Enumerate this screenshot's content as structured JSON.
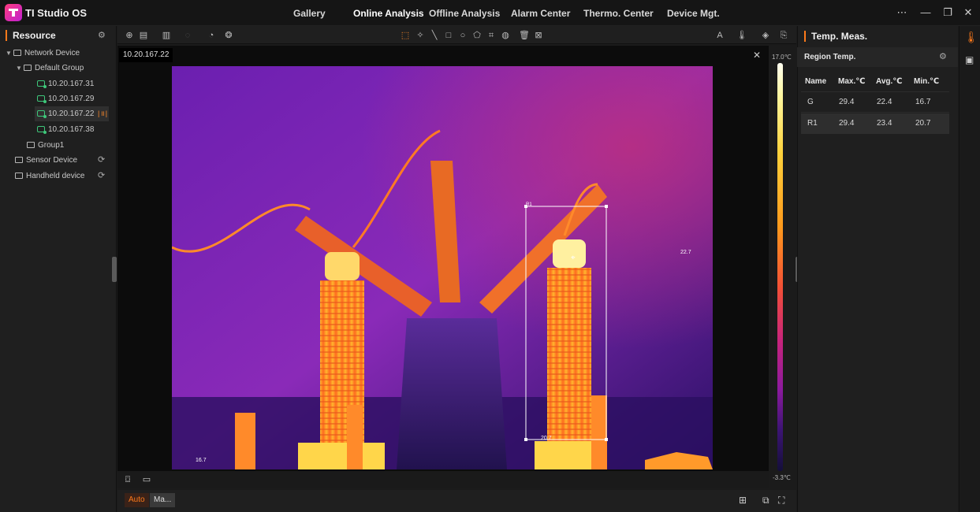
{
  "app": {
    "title": "TI Studio OS"
  },
  "nav": {
    "tabs": [
      "Gallery",
      "Online Analysis",
      "Offline Analysis",
      "Alarm Center",
      "Thermo. Center",
      "Device Mgt."
    ],
    "active": "Online Analysis"
  },
  "window_controls": {
    "more": "⋯",
    "minimize": "—",
    "restore": "❐",
    "close": "✕"
  },
  "resource": {
    "title": "Resource",
    "tree": [
      {
        "label": "Network Device",
        "level": 0,
        "type": "folder",
        "expanded": true
      },
      {
        "label": "Default Group",
        "level": 1,
        "type": "folder",
        "expanded": true
      },
      {
        "label": "10.20.167.31",
        "level": 2,
        "type": "camera"
      },
      {
        "label": "10.20.167.29",
        "level": 2,
        "type": "camera"
      },
      {
        "label": "10.20.167.22",
        "level": 2,
        "type": "camera",
        "selected": true,
        "live": true
      },
      {
        "label": "10.20.167.38",
        "level": 2,
        "type": "camera"
      },
      {
        "label": "Group1",
        "level": 1,
        "type": "folder"
      },
      {
        "label": "Sensor Device",
        "level": 0,
        "type": "folder",
        "refresh": true
      },
      {
        "label": "Handheld device",
        "level": 0,
        "type": "folder",
        "refresh": true
      }
    ]
  },
  "video": {
    "tab": "10.20.167.22",
    "scale_max": "17.0℃",
    "scale_min": "-3.3℃",
    "overlay": {
      "region_label": "R1",
      "point_right": "22.7",
      "point_bottom": "20.7",
      "point_left": "16.7"
    }
  },
  "bottom": {
    "auto": "Auto",
    "manual": "Ma..."
  },
  "temp_meas": {
    "title": "Temp. Meas.",
    "section": "Region Temp.",
    "columns": [
      "Name",
      "Max.℃",
      "Avg.℃",
      "Min.℃"
    ],
    "rows": [
      [
        "G",
        "29.4",
        "22.4",
        "16.7"
      ],
      [
        "R1",
        "29.4",
        "23.4",
        "20.7"
      ]
    ]
  },
  "colors": {
    "accent": "#ff7a1a",
    "live": "#3ec77a"
  },
  "icons": [
    "zoom-icon",
    "palette-icon",
    "point-tool-icon",
    "line-tool-icon",
    "rect-tool-icon",
    "circle-tool-icon",
    "polygon-tool-icon",
    "delete-icon",
    "thermometer-icon",
    "snapshot-icon",
    "record-icon",
    "layout-icon",
    "fullscreen-icon"
  ]
}
